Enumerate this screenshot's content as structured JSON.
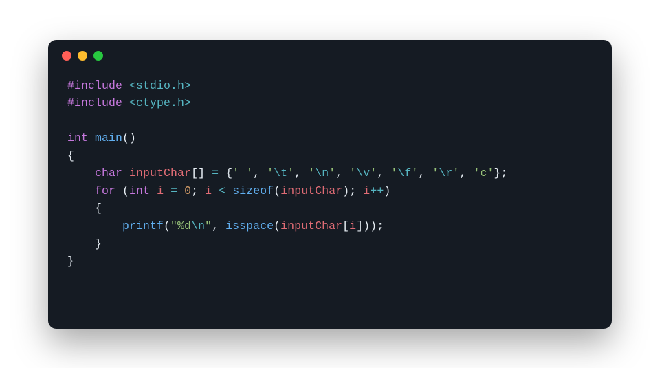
{
  "window": {
    "dots": [
      "red",
      "yellow",
      "green"
    ]
  },
  "colors": {
    "bg": "#151b23",
    "red": "#ff5f57",
    "yellow": "#febc2e",
    "green": "#28c840",
    "pp": "#c678dd",
    "inc": "#56b6c2",
    "type": "#c678dd",
    "fn": "#61afef",
    "punc": "#e6edf3",
    "op": "#56b6c2",
    "id": "#e06c75",
    "num": "#d19a66",
    "str": "#98c379",
    "esc": "#56b6c2",
    "kw": "#c678dd"
  },
  "code_plain": "#include <stdio.h>\n#include <ctype.h>\n\nint main()\n{\n    char inputChar[] = {' ', '\\t', '\\n', '\\v', '\\f', '\\r', 'c'};\n    for (int i = 0; i < sizeof(inputChar); i++)\n    {\n        printf(\"%d\\n\", isspace(inputChar[i]));\n    }\n}",
  "code_lines": [
    [
      {
        "t": "#include",
        "c": "pp"
      },
      {
        "t": " ",
        "c": "punc"
      },
      {
        "t": "<stdio.h>",
        "c": "inc"
      }
    ],
    [
      {
        "t": "#include",
        "c": "pp"
      },
      {
        "t": " ",
        "c": "punc"
      },
      {
        "t": "<ctype.h>",
        "c": "inc"
      }
    ],
    [],
    [
      {
        "t": "int",
        "c": "type"
      },
      {
        "t": " ",
        "c": "punc"
      },
      {
        "t": "main",
        "c": "fn"
      },
      {
        "t": "()",
        "c": "punc"
      }
    ],
    [
      {
        "t": "{",
        "c": "punc"
      }
    ],
    [
      {
        "t": "    ",
        "c": "punc"
      },
      {
        "t": "char",
        "c": "type"
      },
      {
        "t": " ",
        "c": "punc"
      },
      {
        "t": "inputChar",
        "c": "id"
      },
      {
        "t": "[] ",
        "c": "punc"
      },
      {
        "t": "=",
        "c": "op"
      },
      {
        "t": " {",
        "c": "punc"
      },
      {
        "t": "' '",
        "c": "str"
      },
      {
        "t": ", ",
        "c": "punc"
      },
      {
        "t": "'",
        "c": "str"
      },
      {
        "t": "\\t",
        "c": "esc"
      },
      {
        "t": "'",
        "c": "str"
      },
      {
        "t": ", ",
        "c": "punc"
      },
      {
        "t": "'",
        "c": "str"
      },
      {
        "t": "\\n",
        "c": "esc"
      },
      {
        "t": "'",
        "c": "str"
      },
      {
        "t": ", ",
        "c": "punc"
      },
      {
        "t": "'",
        "c": "str"
      },
      {
        "t": "\\v",
        "c": "esc"
      },
      {
        "t": "'",
        "c": "str"
      },
      {
        "t": ", ",
        "c": "punc"
      },
      {
        "t": "'",
        "c": "str"
      },
      {
        "t": "\\f",
        "c": "esc"
      },
      {
        "t": "'",
        "c": "str"
      },
      {
        "t": ", ",
        "c": "punc"
      },
      {
        "t": "'",
        "c": "str"
      },
      {
        "t": "\\r",
        "c": "esc"
      },
      {
        "t": "'",
        "c": "str"
      },
      {
        "t": ", ",
        "c": "punc"
      },
      {
        "t": "'c'",
        "c": "str"
      },
      {
        "t": "};",
        "c": "punc"
      }
    ],
    [
      {
        "t": "    ",
        "c": "punc"
      },
      {
        "t": "for",
        "c": "kw"
      },
      {
        "t": " (",
        "c": "punc"
      },
      {
        "t": "int",
        "c": "type"
      },
      {
        "t": " ",
        "c": "punc"
      },
      {
        "t": "i",
        "c": "id"
      },
      {
        "t": " ",
        "c": "punc"
      },
      {
        "t": "=",
        "c": "op"
      },
      {
        "t": " ",
        "c": "punc"
      },
      {
        "t": "0",
        "c": "num"
      },
      {
        "t": "; ",
        "c": "punc"
      },
      {
        "t": "i",
        "c": "id"
      },
      {
        "t": " ",
        "c": "punc"
      },
      {
        "t": "<",
        "c": "op"
      },
      {
        "t": " ",
        "c": "punc"
      },
      {
        "t": "sizeof",
        "c": "fn"
      },
      {
        "t": "(",
        "c": "punc"
      },
      {
        "t": "inputChar",
        "c": "id"
      },
      {
        "t": "); ",
        "c": "punc"
      },
      {
        "t": "i",
        "c": "id"
      },
      {
        "t": "++",
        "c": "op"
      },
      {
        "t": ")",
        "c": "punc"
      }
    ],
    [
      {
        "t": "    {",
        "c": "punc"
      }
    ],
    [
      {
        "t": "        ",
        "c": "punc"
      },
      {
        "t": "printf",
        "c": "fn"
      },
      {
        "t": "(",
        "c": "punc"
      },
      {
        "t": "\"%d",
        "c": "str"
      },
      {
        "t": "\\n",
        "c": "esc"
      },
      {
        "t": "\"",
        "c": "str"
      },
      {
        "t": ", ",
        "c": "punc"
      },
      {
        "t": "isspace",
        "c": "fn"
      },
      {
        "t": "(",
        "c": "punc"
      },
      {
        "t": "inputChar",
        "c": "id"
      },
      {
        "t": "[",
        "c": "punc"
      },
      {
        "t": "i",
        "c": "id"
      },
      {
        "t": "]));",
        "c": "punc"
      }
    ],
    [
      {
        "t": "    }",
        "c": "punc"
      }
    ],
    [
      {
        "t": "}",
        "c": "punc"
      }
    ]
  ]
}
